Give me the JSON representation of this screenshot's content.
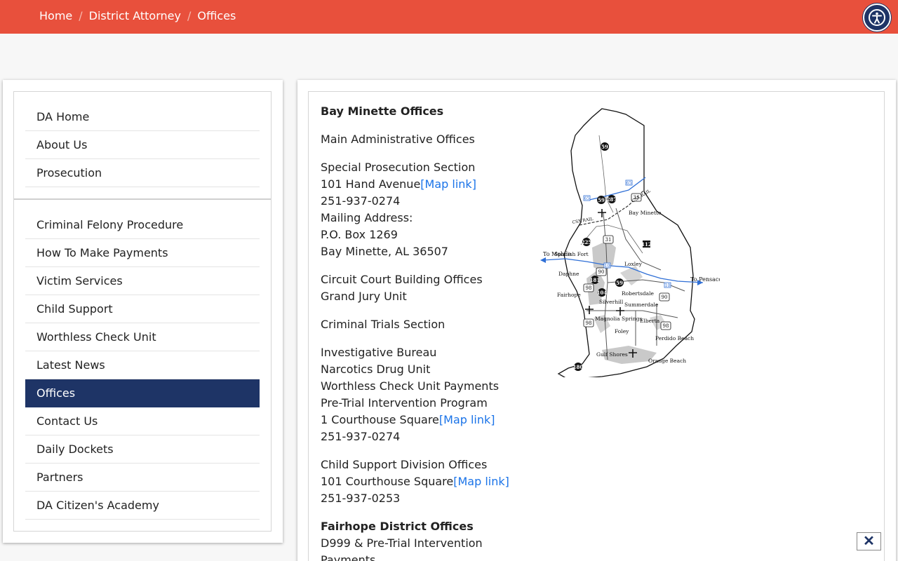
{
  "breadcrumb": [
    "Home",
    "District Attorney",
    "Offices"
  ],
  "accessibility_icon": "accessibility-icon",
  "sidebar": {
    "group1": [
      "DA Home",
      "About Us",
      "Prosecution"
    ],
    "group2": [
      "Criminal Felony Procedure",
      "How To Make Payments",
      "Victim Services",
      "Child Support",
      "Worthless Check Unit",
      "Latest News",
      "Offices",
      "Contact Us",
      "Daily Dockets",
      "Partners",
      "DA Citizen's Academy"
    ],
    "active": "Offices"
  },
  "content": {
    "bay_title": "Bay Minette Offices",
    "main_admin": "Main Administrative Offices",
    "special_section": "Special Prosecution Section",
    "special_address": "101 Hand Avenue",
    "map_link": "[Map link]",
    "special_phone": "251-937-0274",
    "mailing_label": "Mailing Address:",
    "mailing_box": "P.O. Box 1269",
    "mailing_city": "Bay Minette, AL 36507",
    "circuit": "Circuit Court Building Offices",
    "grand_jury": "Grand Jury Unit",
    "criminal_trials": "Criminal Trials Section",
    "investigative": "Investigative Bureau",
    "narcotics": "Narcotics Drug Unit",
    "worthless_payments": "Worthless Check Unit Payments",
    "pretrial": "Pre-Trial Intervention Program",
    "courthouse_address": "1 Courthouse Square",
    "courthouse_phone": "251-937-0274",
    "child_support": "Child Support Division Offices",
    "child_address": "101 Courthouse Square",
    "child_phone": "251-937-0253",
    "fairhope_title": "Fairhope District Offices",
    "fairhope_line1": "D999 & Pre-Trial Intervention",
    "fairhope_line2": "Payments"
  },
  "map": {
    "towns": [
      "Bay Minette",
      "Spanish Fort",
      "Loxley",
      "Daphne",
      "Fairhope",
      "Robertsdale",
      "Silverhill",
      "Summerdale",
      "Magnolia Springs",
      "Elberta",
      "Foley",
      "Perdido Beach",
      "Gulf Shores",
      "Orange Beach"
    ],
    "arrows": [
      "To Mobile",
      "To Pensacola"
    ],
    "rail": [
      "CSX RAIL",
      "CSX RAIL"
    ],
    "routes": [
      "59",
      "287",
      "31",
      "225",
      "31",
      "112",
      "181",
      "90",
      "59",
      "104",
      "90",
      "98",
      "98",
      "98",
      "180"
    ],
    "interstates": [
      "65",
      "10"
    ]
  },
  "close_label": "✕"
}
